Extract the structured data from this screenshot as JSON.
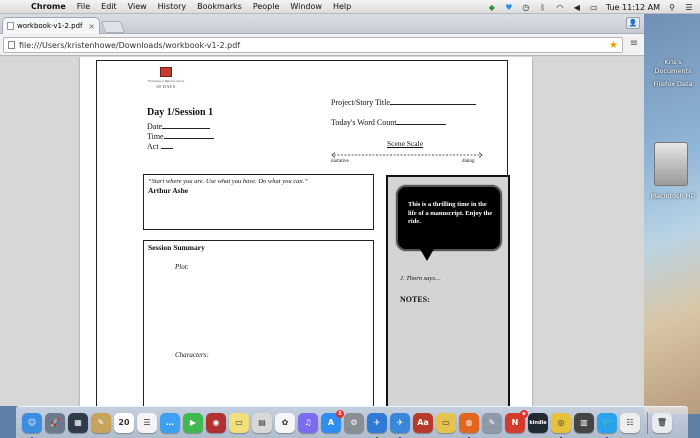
{
  "menubar": {
    "apple_glyph": "",
    "app_name": "Chrome",
    "items": [
      "File",
      "Edit",
      "View",
      "History",
      "Bookmarks",
      "People",
      "Window",
      "Help"
    ],
    "clock": "Tue 11:12 AM",
    "status_icons": [
      "dropbox-icon",
      "twitter-icon",
      "time-machine-icon",
      "bluetooth-icon",
      "wifi-icon",
      "volume-icon",
      "battery-icon",
      "spotlight-icon",
      "notification-center-icon"
    ]
  },
  "browser": {
    "tab_title": "workbook-v1-2.pdf",
    "tab_close": "×",
    "url": "file:///Users/kristenhowe/Downloads/workbook-v1-2.pdf",
    "profile_glyph": "👤",
    "menu_glyph": "≡"
  },
  "desktop": {
    "items": [
      "Kris's",
      "Documents",
      "Firefox Data",
      "Macintosh HD"
    ]
  },
  "pdf": {
    "logo_tagline": "Finishing a Manuscript in",
    "logo_days": "60 DAYS",
    "day_title": "Day 1/Session 1",
    "fields": [
      "Date",
      "Time",
      "Act"
    ],
    "project_label": "Project/Story Title",
    "wordcount_label": "Today's Word Count",
    "scene_scale": "Scene Scale",
    "scale_left": "narrative",
    "scale_right": "dialog",
    "quote": "“Start where you are. Use what you have. Do what you can.”",
    "quote_author": "Arthur Ashe",
    "summary_title": "Session Summary",
    "plot_label": "Plot:",
    "characters_label": "Characters:",
    "bubble_text": "This is a thrilling time in the life of a manuscript. Enjoy the ride.",
    "attribution": "J. Thorn says…",
    "notes_label": "NOTES:"
  },
  "dock": {
    "apps": [
      {
        "name": "finder",
        "glyph": "☺",
        "color": "#3b8de0",
        "running": true
      },
      {
        "name": "launchpad",
        "glyph": "🚀",
        "color": "#6b7a8c",
        "running": false
      },
      {
        "name": "mission-control",
        "glyph": "▦",
        "color": "#2f3b4a",
        "running": false
      },
      {
        "name": "notes-app",
        "glyph": "✎",
        "color": "#c8a35a",
        "running": false
      },
      {
        "name": "calendar",
        "glyph": "20",
        "color": "#ffffff",
        "running": false
      },
      {
        "name": "reminders",
        "glyph": "☰",
        "color": "#f4f4f4",
        "running": false
      },
      {
        "name": "messages",
        "glyph": "…",
        "color": "#3ea0f0",
        "running": false
      },
      {
        "name": "facetime",
        "glyph": "▶",
        "color": "#3fb950",
        "running": false
      },
      {
        "name": "photo-booth",
        "glyph": "◉",
        "color": "#b23030",
        "running": false
      },
      {
        "name": "stickies",
        "glyph": "▭",
        "color": "#f1e07a",
        "running": false
      },
      {
        "name": "preview",
        "glyph": "▤",
        "color": "#d8d8d8",
        "running": false
      },
      {
        "name": "photos",
        "glyph": "✿",
        "color": "#f6f6f6",
        "running": false
      },
      {
        "name": "itunes",
        "glyph": "♫",
        "color": "#7b6cf0",
        "running": false
      },
      {
        "name": "app-store",
        "glyph": "A",
        "color": "#2f8ef0",
        "running": false,
        "badge": "5"
      },
      {
        "name": "system-preferences",
        "glyph": "⚙",
        "color": "#8a8f96",
        "running": false
      },
      {
        "name": "wunderlist",
        "glyph": "✈",
        "color": "#2f7ad6",
        "running": true
      },
      {
        "name": "safari-like",
        "glyph": "✈",
        "color": "#3a86d8",
        "running": true
      },
      {
        "name": "dictionary",
        "glyph": "Aa",
        "color": "#b93a2a",
        "running": false
      },
      {
        "name": "stickies-2",
        "glyph": "▭",
        "color": "#e6c24f",
        "running": false
      },
      {
        "name": "firefox",
        "glyph": "◍",
        "color": "#e2661f",
        "running": true
      },
      {
        "name": "script-editor",
        "glyph": "✎",
        "color": "#8e9aa8",
        "running": false
      },
      {
        "name": "news",
        "glyph": "N",
        "color": "#d43b2c",
        "running": false,
        "badge": "⊕"
      },
      {
        "name": "kindle",
        "glyph": "kindle",
        "color": "#1f2a33",
        "running": false
      },
      {
        "name": "chrome",
        "glyph": "◎",
        "color": "#e8c13a",
        "running": true
      },
      {
        "name": "books",
        "glyph": "▥",
        "color": "#444444",
        "running": false
      },
      {
        "name": "twitter",
        "glyph": "🐦",
        "color": "#2aa3ef",
        "running": true
      },
      {
        "name": "list-app",
        "glyph": "☷",
        "color": "#eeeeee",
        "running": false
      }
    ],
    "trash_glyph": "🗑"
  }
}
